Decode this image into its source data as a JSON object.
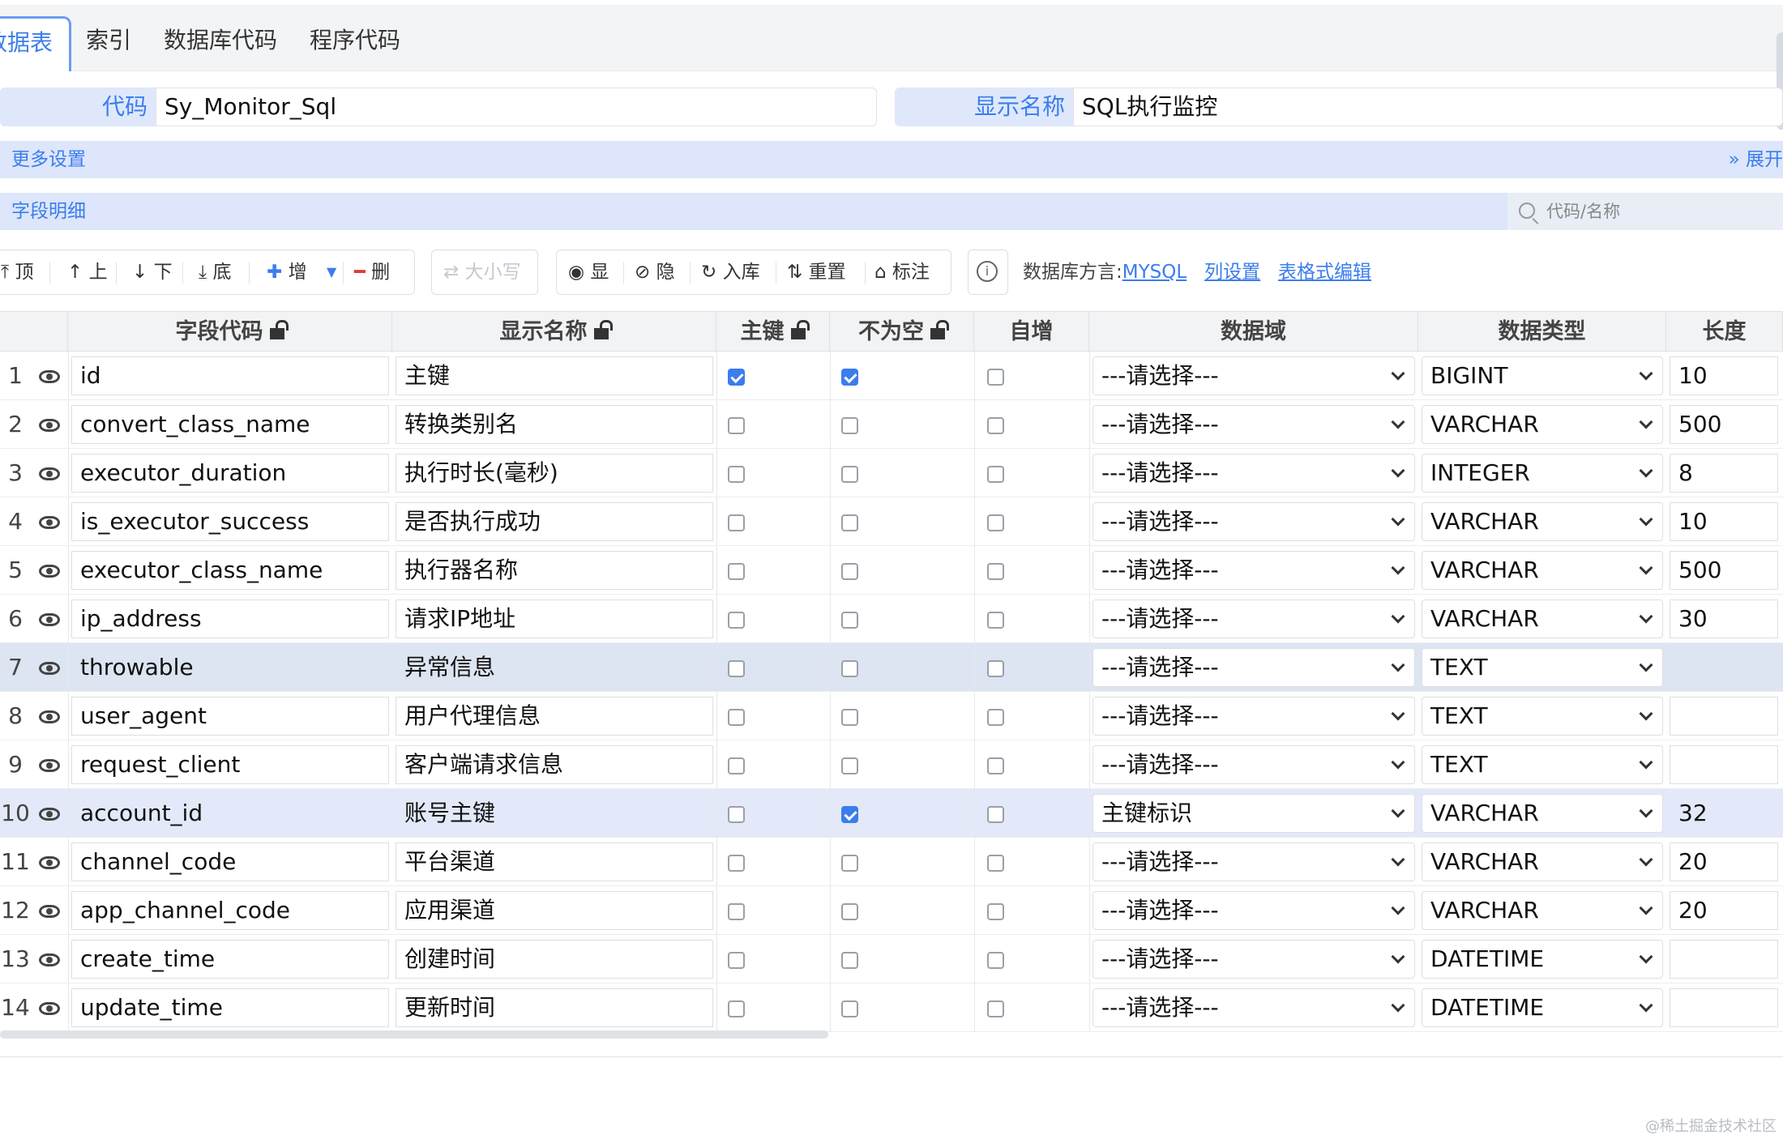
{
  "tabs": [
    {
      "label": "数据表",
      "active": true
    },
    {
      "label": "索引"
    },
    {
      "label": "数据库代码"
    },
    {
      "label": "程序代码"
    }
  ],
  "form": {
    "code_label": "代码",
    "code_value": "Sy_Monitor_Sql",
    "name_label": "显示名称",
    "name_value": "SQL执行监控"
  },
  "more_settings": {
    "label": "更多设置",
    "expand": "展开"
  },
  "fields_section": {
    "label": "字段明细",
    "search_placeholder": "代码/名称"
  },
  "toolbar": {
    "top": "顶",
    "up": "上",
    "down": "下",
    "bottom": "底",
    "add": "增",
    "delete": "删",
    "case": "大小写",
    "show": "显",
    "hide": "隐",
    "import": "入库",
    "reset": "重置",
    "mark": "标注",
    "dialect_label": "数据库方言:",
    "dialect_value": "MYSQL",
    "col_settings": "列设置",
    "table_edit": "表格式编辑"
  },
  "columns": {
    "code": "字段代码",
    "name": "显示名称",
    "pk": "主键",
    "notnull": "不为空",
    "auto": "自增",
    "domain": "数据域",
    "type": "数据类型",
    "length": "长度"
  },
  "rows": [
    {
      "n": "1",
      "code": "id",
      "name": "主键",
      "pk": true,
      "notnull": true,
      "auto": false,
      "domain": "---请选择---",
      "type": "BIGINT",
      "length": "10"
    },
    {
      "n": "2",
      "code": "convert_class_name",
      "name": "转换类别名",
      "pk": false,
      "notnull": false,
      "auto": false,
      "domain": "---请选择---",
      "type": "VARCHAR",
      "length": "500"
    },
    {
      "n": "3",
      "code": "executor_duration",
      "name": "执行时长(毫秒)",
      "pk": false,
      "notnull": false,
      "auto": false,
      "domain": "---请选择---",
      "type": "INTEGER",
      "length": "8"
    },
    {
      "n": "4",
      "code": "is_executor_success",
      "name": "是否执行成功",
      "pk": false,
      "notnull": false,
      "auto": false,
      "domain": "---请选择---",
      "type": "VARCHAR",
      "length": "10"
    },
    {
      "n": "5",
      "code": "executor_class_name",
      "name": "执行器名称",
      "pk": false,
      "notnull": false,
      "auto": false,
      "domain": "---请选择---",
      "type": "VARCHAR",
      "length": "500"
    },
    {
      "n": "6",
      "code": "ip_address",
      "name": "请求IP地址",
      "pk": false,
      "notnull": false,
      "auto": false,
      "domain": "---请选择---",
      "type": "VARCHAR",
      "length": "30"
    },
    {
      "n": "7",
      "code": "throwable",
      "name": "异常信息",
      "pk": false,
      "notnull": false,
      "auto": false,
      "domain": "---请选择---",
      "type": "TEXT",
      "length": "",
      "style": "sel"
    },
    {
      "n": "8",
      "code": "user_agent",
      "name": "用户代理信息",
      "pk": false,
      "notnull": false,
      "auto": false,
      "domain": "---请选择---",
      "type": "TEXT",
      "length": ""
    },
    {
      "n": "9",
      "code": "request_client",
      "name": "客户端请求信息",
      "pk": false,
      "notnull": false,
      "auto": false,
      "domain": "---请选择---",
      "type": "TEXT",
      "length": ""
    },
    {
      "n": "10",
      "code": "account_id",
      "name": "账号主键",
      "pk": false,
      "notnull": true,
      "auto": false,
      "domain": "主键标识",
      "type": "VARCHAR",
      "length": "32",
      "style": "sel2"
    },
    {
      "n": "11",
      "code": "channel_code",
      "name": "平台渠道",
      "pk": false,
      "notnull": false,
      "auto": false,
      "domain": "---请选择---",
      "type": "VARCHAR",
      "length": "20"
    },
    {
      "n": "12",
      "code": "app_channel_code",
      "name": "应用渠道",
      "pk": false,
      "notnull": false,
      "auto": false,
      "domain": "---请选择---",
      "type": "VARCHAR",
      "length": "20"
    },
    {
      "n": "13",
      "code": "create_time",
      "name": "创建时间",
      "pk": false,
      "notnull": false,
      "auto": false,
      "domain": "---请选择---",
      "type": "DATETIME",
      "length": ""
    },
    {
      "n": "14",
      "code": "update_time",
      "name": "更新时间",
      "pk": false,
      "notnull": false,
      "auto": false,
      "domain": "---请选择---",
      "type": "DATETIME",
      "length": ""
    }
  ],
  "watermark": "@稀土掘金技术社区"
}
